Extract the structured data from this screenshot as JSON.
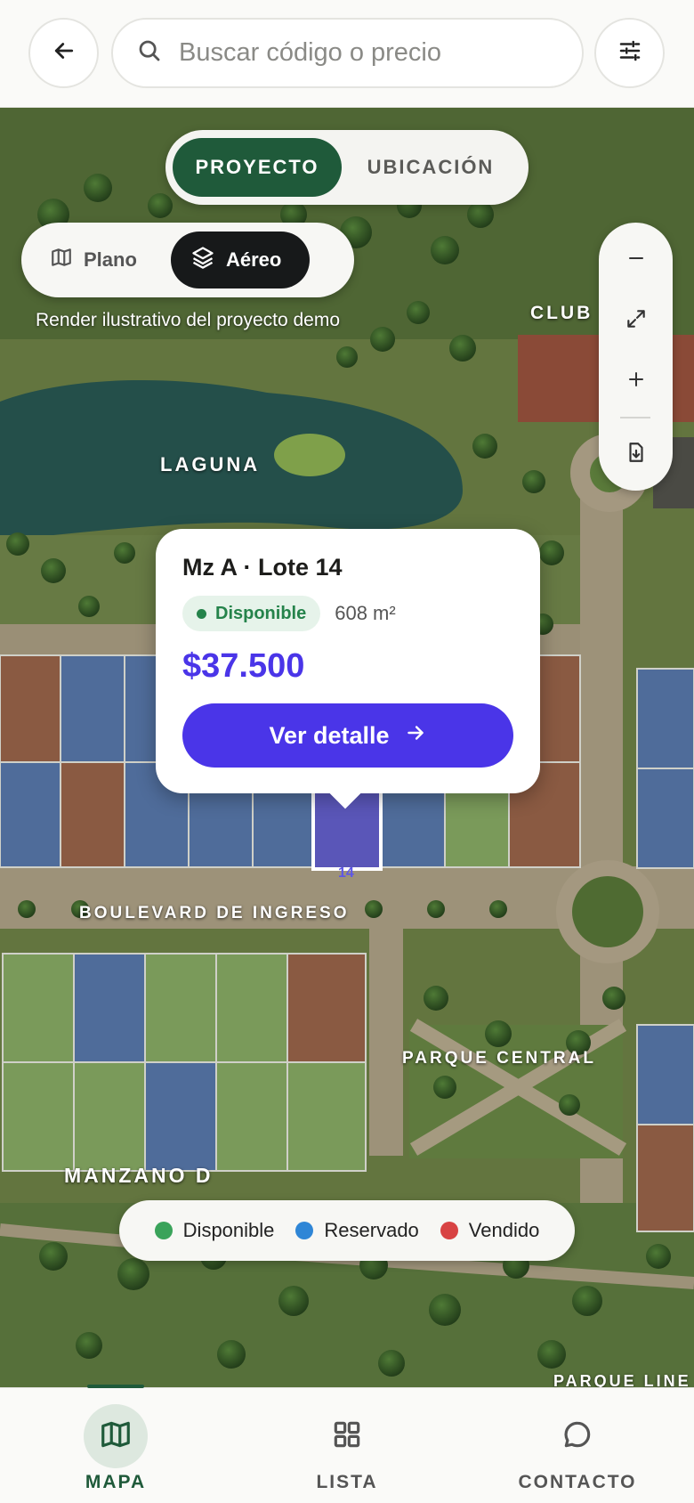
{
  "header": {
    "back_icon": "arrow-left-icon",
    "search_icon": "search-icon",
    "search_placeholder": "Buscar código o precio",
    "search_value": "",
    "filter_icon": "sliders-icon"
  },
  "map": {
    "mode_tabs": [
      {
        "label": "PROYECTO",
        "active": true
      },
      {
        "label": "UBICACIÓN",
        "active": false
      }
    ],
    "view_toggle": [
      {
        "label": "Plano",
        "icon": "map-icon",
        "active": false
      },
      {
        "label": "Aéreo",
        "icon": "layers-icon",
        "active": true
      }
    ],
    "caption": "Render ilustrativo del proyecto demo",
    "controls": {
      "zoom_out_icon": "minus-icon",
      "fullscreen_icon": "expand-icon",
      "zoom_in_icon": "plus-icon",
      "download_icon": "download-icon"
    },
    "labels": {
      "club": "CLUB H",
      "laguna": "LAGUNA",
      "boulevard": "BOULEVARD DE INGRESO",
      "parque_central": "PARQUE CENTRAL",
      "manzana_d": "MANZANO D",
      "parque_lineal": "PARQUE LINE"
    },
    "selected_lot_number": "14"
  },
  "popup": {
    "title": "Mz A · Lote 14",
    "status": "Disponible",
    "area": "608 m²",
    "price": "$37.500",
    "cta_label": "Ver detalle",
    "cta_icon": "arrow-right-icon"
  },
  "legend": [
    {
      "label": "Disponible",
      "color": "#3aa35a"
    },
    {
      "label": "Reservado",
      "color": "#2f86d6"
    },
    {
      "label": "Vendido",
      "color": "#d84343"
    }
  ],
  "bottom_nav": [
    {
      "label": "MAPA",
      "icon": "map-icon",
      "active": true
    },
    {
      "label": "LISTA",
      "icon": "grid-icon",
      "active": false
    },
    {
      "label": "CONTACTO",
      "icon": "chat-icon",
      "active": false
    }
  ],
  "colors": {
    "accent_green": "#1f5a3a",
    "accent_purple": "#4a35e8",
    "lot_available": "#7a9a5a",
    "lot_reserved": "#4f6c9a",
    "lot_sold": "#8a5a42"
  }
}
